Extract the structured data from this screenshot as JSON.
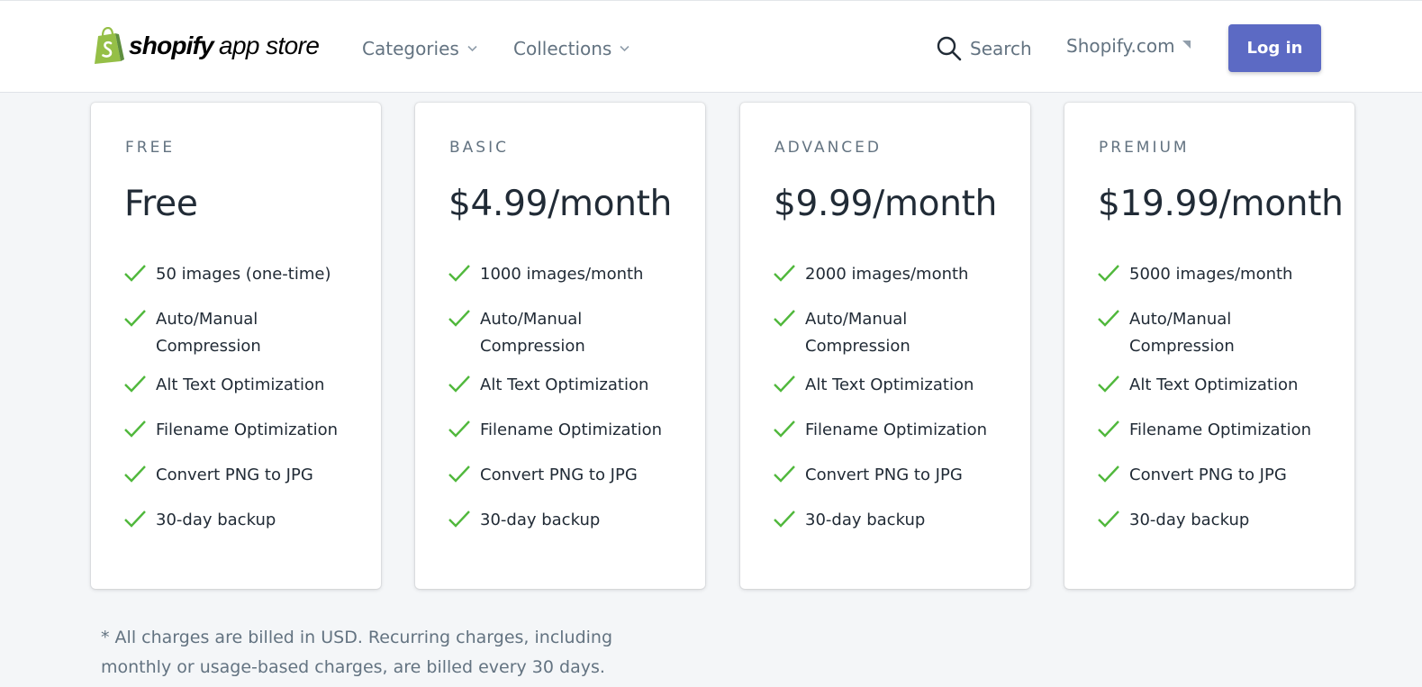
{
  "header": {
    "logo_text": "shopify",
    "logo_sub": "app store",
    "nav": [
      {
        "label": "Categories"
      },
      {
        "label": "Collections"
      }
    ],
    "search_label": "Search",
    "shopify_link": "Shopify.com",
    "login_label": "Log in"
  },
  "plans": [
    {
      "name": "FREE",
      "price": "Free",
      "features": [
        "50 images (one-time)",
        "Auto/Manual Compression",
        "Alt Text Optimization",
        "Filename Optimization",
        "Convert PNG to JPG",
        "30-day backup"
      ]
    },
    {
      "name": "BASIC",
      "price": "$4.99/month",
      "features": [
        "1000 images/month",
        "Auto/Manual Compression",
        "Alt Text Optimization",
        "Filename Optimization",
        "Convert PNG to JPG",
        "30-day backup"
      ]
    },
    {
      "name": "ADVANCED",
      "price": "$9.99/month",
      "features": [
        "2000 images/month",
        "Auto/Manual Compression",
        "Alt Text Optimization",
        "Filename Optimization",
        "Convert PNG to JPG",
        "30-day backup"
      ]
    },
    {
      "name": "PREMIUM",
      "price": "$19.99/month",
      "features": [
        "5000 images/month",
        "Auto/Manual Compression",
        "Alt Text Optimization",
        "Filename Optimization",
        "Convert PNG to JPG",
        "30-day backup"
      ]
    }
  ],
  "footnote": "* All charges are billed in USD. Recurring charges, including monthly or usage-based charges, are billed every 30 days.",
  "colors": {
    "brand_green": "#95bf47",
    "check_green": "#50b83c",
    "login_bg": "#5c6ac4",
    "page_bg": "#f4f6f8"
  },
  "icons": {
    "logo": "shopify-bag-icon",
    "search": "search-icon",
    "dropdown": "chevron-down-icon",
    "external": "corner-arrow-icon",
    "feature": "checkmark-icon"
  }
}
